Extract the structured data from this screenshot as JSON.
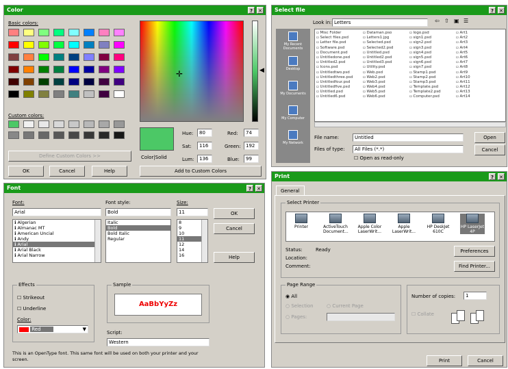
{
  "color_dialog": {
    "title": "Color",
    "basic_colors_label": "Basic colors:",
    "custom_colors_label": "Custom colors:",
    "define_custom_label": "Define Custom Colors >>",
    "ok": "OK",
    "cancel": "Cancel",
    "help": "Help",
    "add_custom": "Add to Custom Colors",
    "colorsolid_label": "Color|Solid",
    "hue_label": "Hue:",
    "hue_value": "80",
    "sat_label": "Sat:",
    "sat_value": "116",
    "lum_label": "Lum:",
    "lum_value": "136",
    "red_label": "Red:",
    "red_value": "74",
    "green_label": "Green:",
    "green_value": "192",
    "blue_label": "Blue:",
    "blue_value": "99",
    "selected_color": "#4cc866",
    "basic_colors": [
      "#ff8080",
      "#ffff80",
      "#80ff80",
      "#00ff80",
      "#80ffff",
      "#0080ff",
      "#ff80c0",
      "#ff80ff",
      "#ff0000",
      "#ffff00",
      "#80ff00",
      "#00ff40",
      "#00ffff",
      "#0080c0",
      "#8080c0",
      "#ff00ff",
      "#804040",
      "#ff8040",
      "#00ff00",
      "#008080",
      "#004080",
      "#8080ff",
      "#800040",
      "#ff0080",
      "#800000",
      "#ff8000",
      "#008000",
      "#008040",
      "#0000ff",
      "#0000a0",
      "#800080",
      "#8000ff",
      "#400000",
      "#804000",
      "#004000",
      "#004040",
      "#000080",
      "#000040",
      "#400040",
      "#400080",
      "#000000",
      "#808000",
      "#808040",
      "#808080",
      "#408080",
      "#c0c0c0",
      "#400040",
      "#ffffff"
    ],
    "custom_colors": [
      "#4cc866",
      "#f0f0f0",
      "#e8e8e8",
      "#d8d8d8",
      "#c8c8c8",
      "#b8b8b8",
      "#a8a8a8",
      "#989898",
      "#888888",
      "#787878",
      "#686868",
      "#585858",
      "#484848",
      "#383838",
      "#282828",
      "#181818"
    ]
  },
  "open_dialog": {
    "title": "Select file",
    "lookin_label": "Look in:",
    "lookin_value": "Letters",
    "places": [
      "My Recent Documents",
      "Desktop",
      "My Documents",
      "My Computer",
      "My Network"
    ],
    "files": [
      [
        "Misc Folder",
        "Dataman.pso",
        "logo.psd",
        "Art1"
      ],
      [
        "Select files.psd",
        "Letters1.jpg",
        "sign1.psd",
        "Art2"
      ],
      [
        "Letter file.psd",
        "Selected.psd",
        "sign2.psd",
        "Art3"
      ],
      [
        "Software.psd",
        "Selected2.psd",
        "sign3.psd",
        "Art4"
      ],
      [
        "Document.psd",
        "Untitled.psd",
        "sign4.psd",
        "Art5"
      ],
      [
        "Untitledone.psd",
        "Untitled2.psd",
        "sign5.psd",
        "Art6"
      ],
      [
        "Untitled2.psd",
        "Untitled3.psd",
        "sign6.psd",
        "Art7"
      ],
      [
        "Icons.psd",
        "Utility.psd",
        "sign7.psd",
        "Art8"
      ],
      [
        "Untitledtwo.psd",
        "Web.psd",
        "Stamp1.psd",
        "Art9"
      ],
      [
        "Untitledthree.psd",
        "Web2.psd",
        "Stamp2.psd",
        "Art10"
      ],
      [
        "Untitledfour.psd",
        "Web3.psd",
        "Stamp3.psd",
        "Art11"
      ],
      [
        "Untitledfive.psd",
        "Web4.psd",
        "Template.psd",
        "Art12"
      ],
      [
        "Untitled.psd",
        "Web5.psd",
        "Template2.psd",
        "Art13"
      ],
      [
        "Untitled6.psd",
        "Web6.psd",
        "Computer.psd",
        "Art14"
      ]
    ],
    "filename_label": "File name:",
    "filename_value": "Untitled",
    "filetype_label": "Files of type:",
    "filetype_value": "All Files (*.*)",
    "readonly_label": "Open as read-only",
    "open": "Open",
    "cancel": "Cancel"
  },
  "font_dialog": {
    "title": "Font",
    "font_label": "Font:",
    "font_value": "Arial",
    "fonts": [
      "Algerian",
      "Almanac MT",
      "American Uncial",
      "Andy",
      "Arial",
      "Arial Black",
      "Arial Narrow"
    ],
    "style_label": "Font style:",
    "style_value": "Bold",
    "styles": [
      "Regular",
      "Italic",
      "Bold",
      "Bold Italic"
    ],
    "size_label": "Size:",
    "size_value": "11",
    "sizes": [
      "8",
      "9",
      "10",
      "11",
      "12",
      "14",
      "16"
    ],
    "ok": "OK",
    "cancel": "Cancel",
    "help": "Help",
    "effects_label": "Effects",
    "strikeout": "Strikeout",
    "underline": "Underline",
    "color_label": "Color:",
    "color_value": "Red",
    "sample_label": "Sample",
    "sample_text": "AaBbYyZz",
    "script_label": "Script:",
    "script_value": "Western",
    "info": "This is an OpenType font. This same font will be used on both your printer and your screen."
  },
  "print_dialog": {
    "title": "Print",
    "tab": "General",
    "select_printer_label": "Select Printer",
    "printers": [
      "Printer",
      "ActiveTouch Document...",
      "Apple Color LaserWrit...",
      "Apple LaserWrit...",
      "HP DeskJet 610C",
      "HP LaserJet 4P"
    ],
    "status_label": "Status:",
    "status_value": "Ready",
    "location_label": "Location:",
    "comment_label": "Comment:",
    "preferences": "Preferences",
    "find_printer": "Find Printer...",
    "page_range_label": "Page Range",
    "all": "All",
    "selection": "Selection",
    "current_page": "Current Page",
    "pages": "Pages:",
    "copies_label": "Number of copies:",
    "copies_value": "1",
    "collate": "Collate",
    "print": "Print",
    "cancel": "Cancel"
  }
}
